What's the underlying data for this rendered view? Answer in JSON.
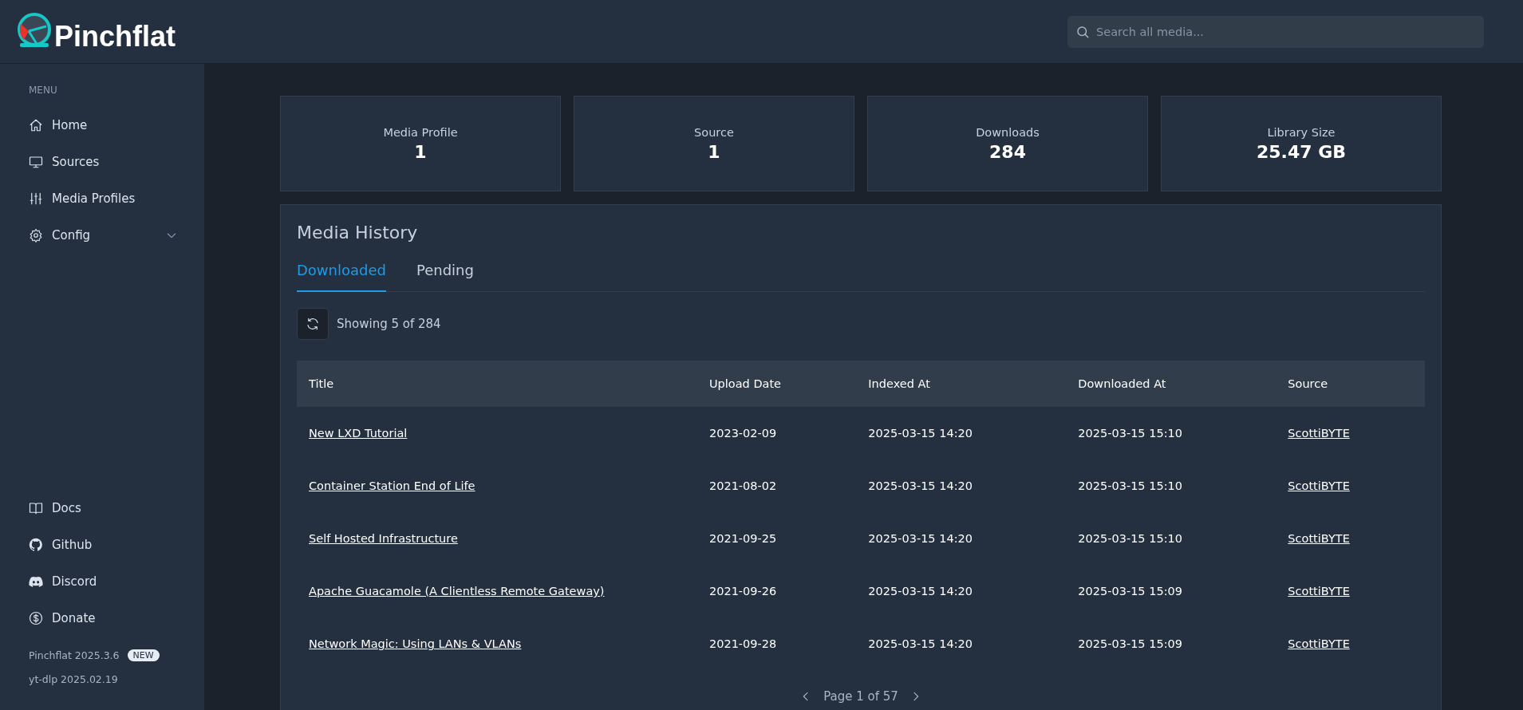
{
  "brand": {
    "name": "Pinchflat"
  },
  "search": {
    "placeholder": "Search all media..."
  },
  "sidebar": {
    "menu_heading": "MENU",
    "items": [
      {
        "label": "Home",
        "kind": "link"
      },
      {
        "label": "Sources",
        "kind": "link"
      },
      {
        "label": "Media Profiles",
        "kind": "link"
      },
      {
        "label": "Config",
        "kind": "group",
        "expanded": false
      }
    ],
    "footer_links": [
      {
        "label": "Docs"
      },
      {
        "label": "Github"
      },
      {
        "label": "Discord"
      },
      {
        "label": "Donate"
      }
    ],
    "versions": [
      {
        "text": "Pinchflat 2025.3.6",
        "badge": "NEW"
      },
      {
        "text": "yt-dlp 2025.02.19"
      }
    ]
  },
  "stats": [
    {
      "label": "Media Profile",
      "value": "1"
    },
    {
      "label": "Source",
      "value": "1"
    },
    {
      "label": "Downloads",
      "value": "284"
    },
    {
      "label": "Library Size",
      "value": "25.47 GB"
    }
  ],
  "media_history": {
    "title": "Media History",
    "tabs": [
      {
        "label": "Downloaded",
        "selected": true
      },
      {
        "label": "Pending",
        "selected": false
      }
    ],
    "showing": "Showing 5 of 284",
    "table": {
      "columns": [
        "Title",
        "Upload Date",
        "Indexed At",
        "Downloaded At",
        "Source"
      ],
      "rows": [
        [
          "New LXD Tutorial",
          "2023-02-09",
          "2025-03-15 14:20",
          "2025-03-15 15:10",
          "ScottiBYTE"
        ],
        [
          "Container Station End of Life",
          "2021-08-02",
          "2025-03-15 14:20",
          "2025-03-15 15:10",
          "ScottiBYTE"
        ],
        [
          "Self Hosted Infrastructure",
          "2021-09-25",
          "2025-03-15 14:20",
          "2025-03-15 15:10",
          "ScottiBYTE"
        ],
        [
          "Apache Guacamole (A Clientless Remote Gateway)",
          "2021-09-26",
          "2025-03-15 14:20",
          "2025-03-15 15:09",
          "ScottiBYTE"
        ],
        [
          "Network Magic: Using LANs & VLANs",
          "2021-09-28",
          "2025-03-15 14:20",
          "2025-03-15 15:09",
          "ScottiBYTE"
        ]
      ]
    },
    "pagination": "Page 1 of 57"
  }
}
